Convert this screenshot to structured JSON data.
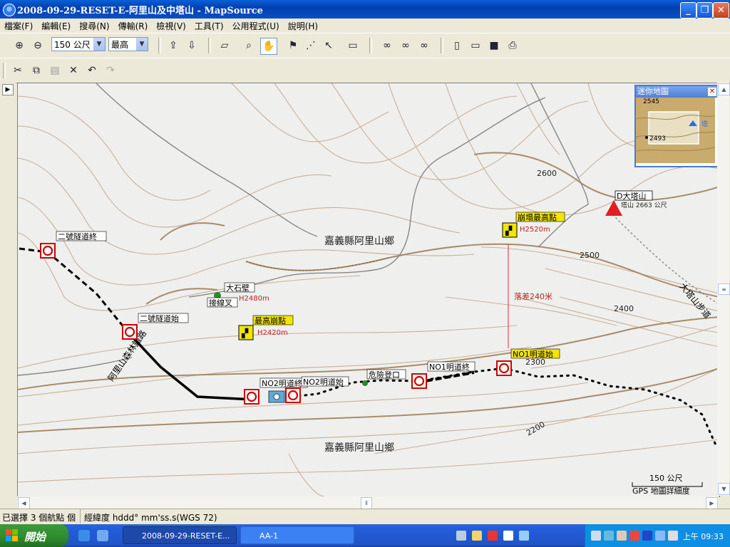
{
  "window": {
    "title": "2008-09-29-RESET-E-阿里山及中塔山 - MapSource"
  },
  "menu": [
    "檔案(F)",
    "編輯(E)",
    "搜尋(N)",
    "傳輸(R)",
    "檢視(V)",
    "工具(T)",
    "公用程式(U)",
    "說明(H)"
  ],
  "toolbar": {
    "zoom_scale": "150 公尺",
    "detail_level": "最高"
  },
  "map": {
    "contours": [
      "2600",
      "2500",
      "2400",
      "2300",
      "2200"
    ],
    "region_labels": [
      "嘉義縣阿里山鄉",
      "嘉義縣阿里山鄉"
    ],
    "road_labels": [
      "阿里山森林鐵路",
      "大塔山步道"
    ],
    "peak": {
      "name": "D大塔山",
      "detail": "塔山 2663 公尺"
    },
    "waypoints": {
      "tunnel2_end": "二號隧道終",
      "tunnel2_start": "二號隧道始",
      "big_rock": "大石壁",
      "big_rock_elev": "H2480m",
      "junction": "接線叉",
      "highest_slope": "最高崩點",
      "highest_slope_elev": "H2420m",
      "collapse_top": "崩塌最高點",
      "collapse_top_elev": "H2520m",
      "drop": "落差240米",
      "no1_start": "NO1明道始",
      "no1_end": "NO1明道終",
      "no2_end": "NO2明道終",
      "no2_start": "NO2明道始",
      "danger_entry": "危險登口"
    },
    "scale_bar": {
      "label": "150 公尺",
      "detail": "GPS 地圖詳細度"
    }
  },
  "minimap": {
    "title": "迷你地圖",
    "label1": "2493",
    "label2": "2545",
    "label3": "塔"
  },
  "status": {
    "selection": "已選擇 3 個航點 個",
    "coords": "經緯度 hddd° mm'ss.s(WGS 72)"
  },
  "taskbar": {
    "start": "開始",
    "tasks": [
      "2008-09-29-RESET-E...",
      "AA-1"
    ],
    "clock": "上午 09:33"
  }
}
